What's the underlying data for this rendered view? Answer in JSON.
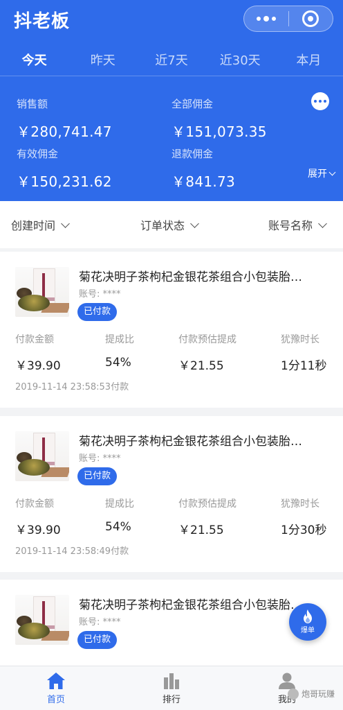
{
  "app": {
    "title": "抖老板"
  },
  "tabs": [
    {
      "label": "今天",
      "active": true
    },
    {
      "label": "昨天",
      "active": false
    },
    {
      "label": "近7天",
      "active": false
    },
    {
      "label": "近30天",
      "active": false
    },
    {
      "label": "本月",
      "active": false
    }
  ],
  "stats": {
    "sales": {
      "label": "销售额",
      "value": "￥280,741.47"
    },
    "total_commission": {
      "label": "全部佣金",
      "value": "￥151,073.35"
    },
    "valid_commission": {
      "label": "有效佣金",
      "value": "￥150,231.62"
    },
    "refund_commission": {
      "label": "退款佣金",
      "value": "￥841.73"
    },
    "expand_label": "展开"
  },
  "filters": [
    {
      "label": "创建时间"
    },
    {
      "label": "订单状态"
    },
    {
      "label": "账号名称"
    }
  ],
  "columns": {
    "amount": "付款金额",
    "rate": "提成比",
    "estimate": "付款预估提成",
    "period": "犹豫时长"
  },
  "orders": [
    {
      "name": "菊花决明子茶枸杞金银花茶组合小包装胎…",
      "account_label": "账号:",
      "account": "****",
      "status": "已付款",
      "amount": "￥39.90",
      "rate": "54%",
      "estimate": "￥21.55",
      "period": "1分11秒",
      "time": "2019-11-14 23:58:53付款"
    },
    {
      "name": "菊花决明子茶枸杞金银花茶组合小包装胎…",
      "account_label": "账号:",
      "account": "****",
      "status": "已付款",
      "amount": "￥39.90",
      "rate": "54%",
      "estimate": "￥21.55",
      "period": "1分30秒",
      "time": "2019-11-14 23:58:49付款"
    },
    {
      "name": "菊花决明子茶枸杞金银花茶组合小包装胎…",
      "account_label": "账号:",
      "account": "****",
      "status": "已付款"
    }
  ],
  "fab": {
    "label": "爆单"
  },
  "tabbar": [
    {
      "label": "首页",
      "icon": "home-icon",
      "active": true
    },
    {
      "label": "排行",
      "icon": "bar-chart-icon",
      "active": false
    },
    {
      "label": "我的",
      "icon": "user-icon",
      "active": false
    }
  ],
  "watermark": "炮哥玩赚",
  "colors": {
    "primary": "#2f6bea"
  }
}
